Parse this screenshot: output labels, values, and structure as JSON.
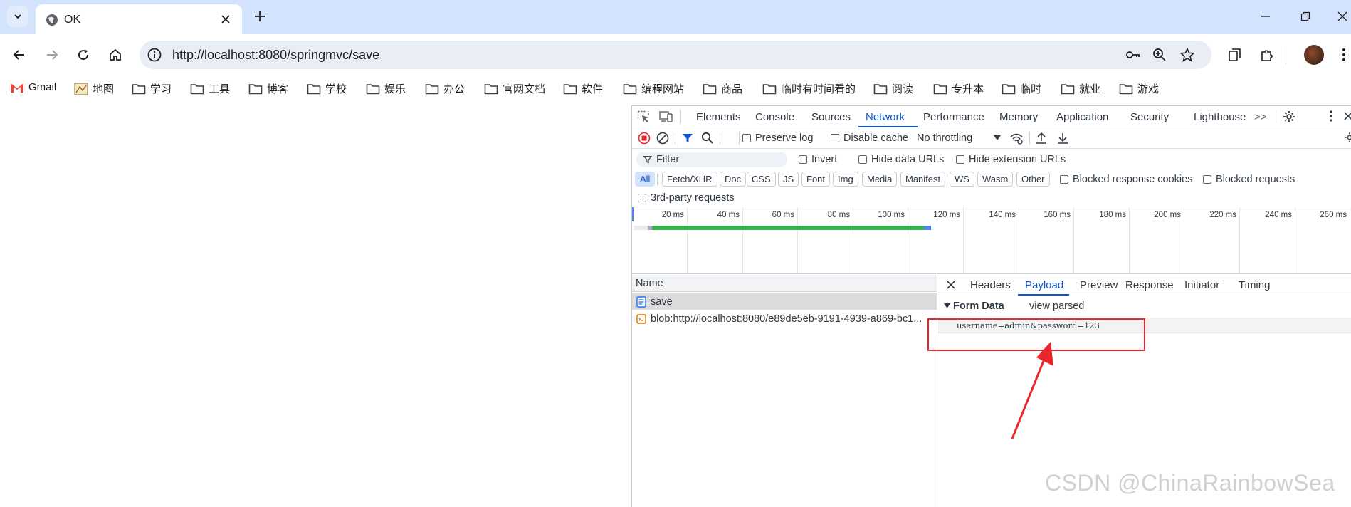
{
  "window": {
    "tab_title": "OK",
    "tab_menu_icon": "chevron-down-icon",
    "tab_favicon": "globe-icon",
    "new_tab_icon": "plus-icon"
  },
  "toolbar": {
    "url": "http://localhost:8080/springmvc/save",
    "site_info_icon": "info-icon",
    "omnibox_icons": [
      "key-icon",
      "zoom-icon",
      "star-icon"
    ],
    "right_icons": [
      "tab-search-icon",
      "extensions-icon",
      "avatar",
      "menu-icon"
    ]
  },
  "bookmarks": [
    {
      "label": "Gmail",
      "icon": "gmail-icon"
    },
    {
      "label": "地图",
      "icon": "map-icon"
    },
    {
      "label": "学习",
      "icon": "folder-icon"
    },
    {
      "label": "工具",
      "icon": "folder-icon"
    },
    {
      "label": "博客",
      "icon": "folder-icon"
    },
    {
      "label": "学校",
      "icon": "folder-icon"
    },
    {
      "label": "娱乐",
      "icon": "folder-icon"
    },
    {
      "label": "办公",
      "icon": "folder-icon"
    },
    {
      "label": "官网文档",
      "icon": "folder-icon"
    },
    {
      "label": "软件",
      "icon": "folder-icon"
    },
    {
      "label": "编程网站",
      "icon": "folder-icon"
    },
    {
      "label": "商品",
      "icon": "folder-icon"
    },
    {
      "label": "临时有时间看的",
      "icon": "folder-icon"
    },
    {
      "label": "阅读",
      "icon": "folder-icon"
    },
    {
      "label": "专升本",
      "icon": "folder-icon"
    },
    {
      "label": "临时",
      "icon": "folder-icon"
    },
    {
      "label": "就业",
      "icon": "folder-icon"
    },
    {
      "label": "游戏",
      "icon": "folder-icon"
    }
  ],
  "devtools": {
    "tabs": [
      "Elements",
      "Console",
      "Sources",
      "Network",
      "Performance",
      "Memory",
      "Application",
      "Security",
      "Lighthouse"
    ],
    "active_tab": "Network",
    "more_tabs": ">>",
    "toolbar": {
      "preserve_log": "Preserve log",
      "disable_cache": "Disable cache",
      "throttling": "No throttling"
    },
    "filter": {
      "placeholder": "Filter",
      "invert": "Invert",
      "hide_data_urls": "Hide data URLs",
      "hide_extension_urls": "Hide extension URLs"
    },
    "types": [
      "All",
      "Fetch/XHR",
      "Doc",
      "CSS",
      "JS",
      "Font",
      "Img",
      "Media",
      "Manifest",
      "WS",
      "Wasm",
      "Other"
    ],
    "active_type": "All",
    "blocked_response_cookies": "Blocked response cookies",
    "blocked_requests": "Blocked requests",
    "third_party": "3rd-party requests",
    "timeline_ticks": [
      "20 ms",
      "40 ms",
      "60 ms",
      "80 ms",
      "100 ms",
      "120 ms",
      "140 ms",
      "160 ms",
      "180 ms",
      "200 ms",
      "220 ms",
      "240 ms",
      "260 ms"
    ],
    "request_list": {
      "header": "Name",
      "rows": [
        {
          "name": "save",
          "icon": "document-icon"
        },
        {
          "name": "blob:http://localhost:8080/e89de5eb-9191-4939-a869-bc1...",
          "icon": "script-icon"
        }
      ]
    },
    "details": {
      "tabs": [
        "Headers",
        "Payload",
        "Preview",
        "Response",
        "Initiator",
        "Timing"
      ],
      "active_tab": "Payload",
      "section_title": "Form Data",
      "view_parsed": "view parsed",
      "payload_text": "username=admin&password=123"
    }
  },
  "annotation": {
    "color": "#e8262b"
  },
  "watermark": "CSDN @ChinaRainbowSea",
  "colors": {
    "tab_strip": "#d3e3fd",
    "accent": "#0b57d0",
    "record": "#e8262b"
  }
}
